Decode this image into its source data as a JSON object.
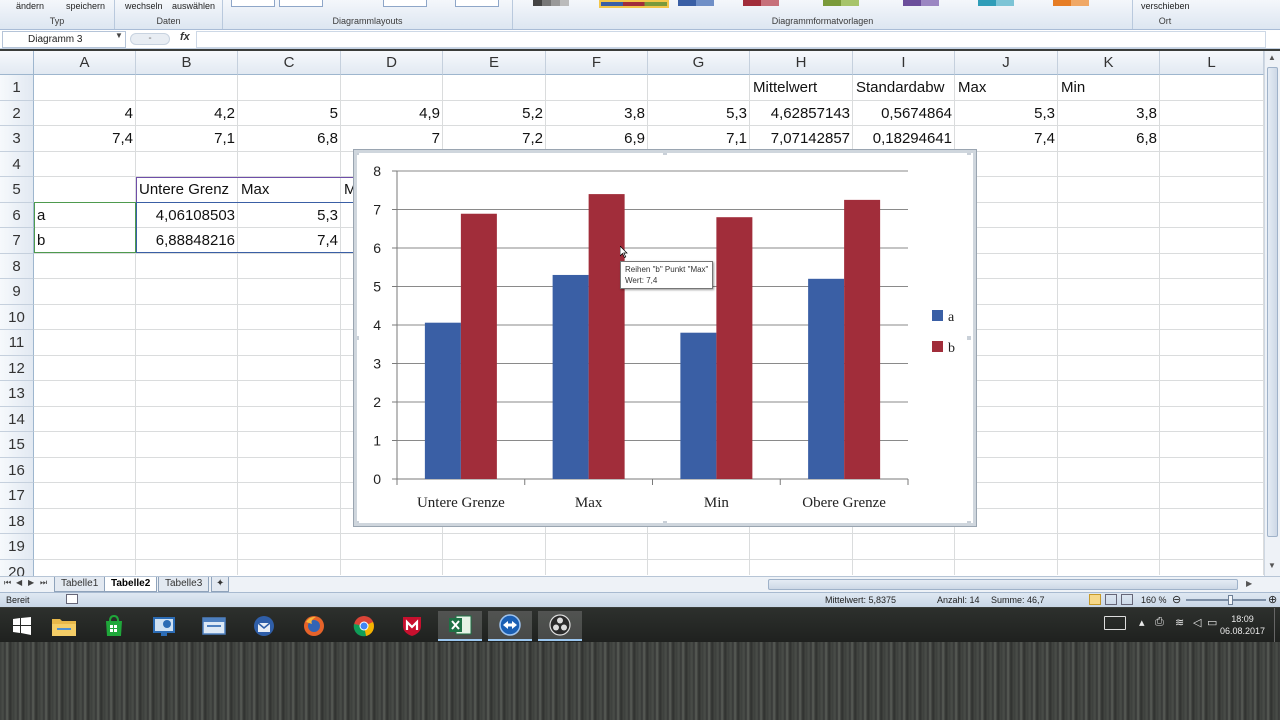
{
  "ribbon": {
    "btn_aendern": "ändern",
    "btn_speichern": "speichern",
    "group_typ": "Typ",
    "btn_wechseln": "wechseln",
    "btn_auswaehlen": "auswählen",
    "group_daten": "Daten",
    "group_layouts": "Diagrammlayouts",
    "group_formatvorlagen": "Diagrammformatvorlagen",
    "btn_verschieben": "verschieben",
    "group_ort": "Ort"
  },
  "formula_bar": {
    "name_box": "Diagramm 3",
    "fx": "fx",
    "value": ""
  },
  "columns": [
    "A",
    "B",
    "C",
    "D",
    "E",
    "F",
    "G",
    "H",
    "I",
    "J",
    "K",
    "L"
  ],
  "rows": [
    "1",
    "2",
    "3",
    "4",
    "5",
    "6",
    "7",
    "8",
    "9",
    "10",
    "11",
    "12",
    "13",
    "14",
    "15",
    "16",
    "17",
    "18",
    "19",
    "20"
  ],
  "cells": {
    "H1": "Mittelwert",
    "I1": "Standardabw",
    "J1": "Max",
    "K1": "Min",
    "A2": "4",
    "B2": "4,2",
    "C2": "5",
    "D2": "4,9",
    "E2": "5,2",
    "F2": "3,8",
    "G2": "5,3",
    "H2": "4,62857143",
    "I2": "0,5674864",
    "J2": "5,3",
    "K2": "3,8",
    "A3": "7,4",
    "B3": "7,1",
    "C3": "6,8",
    "D3": "7",
    "E3": "7,2",
    "F3": "6,9",
    "G3": "7,1",
    "H3": "7,07142857",
    "I3": "0,18294641",
    "J3": "7,4",
    "K3": "6,8",
    "B5": "Untere Grenz",
    "C5": "Max",
    "D5": "M",
    "A6": "a",
    "B6": "4,06108503",
    "C6": "5,3",
    "A7": "b",
    "B7": "6,88848216",
    "C7": "7,4"
  },
  "sheet_tabs": [
    "Tabelle1",
    "Tabelle2",
    "Tabelle3"
  ],
  "active_sheet": "Tabelle2",
  "status_bar": {
    "mode": "Bereit",
    "average": "Mittelwert: 5,8375",
    "count": "Anzahl: 14",
    "sum": "Summe: 46,7",
    "zoom": "160 %"
  },
  "chart_data": {
    "type": "bar",
    "categories": [
      "Untere Grenze",
      "Max",
      "Min",
      "Obere Grenze"
    ],
    "series": [
      {
        "name": "a",
        "values": [
          4.06,
          5.3,
          3.8,
          5.2
        ],
        "color": "#3a5fa5"
      },
      {
        "name": "b",
        "values": [
          6.89,
          7.4,
          6.8,
          7.25
        ],
        "color": "#a12d3a"
      }
    ],
    "ylim": [
      0,
      8
    ],
    "yticks": [
      "0",
      "1",
      "2",
      "3",
      "4",
      "5",
      "6",
      "7",
      "8"
    ],
    "grid": true,
    "legend_placement": "right",
    "title": "",
    "xlabel": "",
    "ylabel": ""
  },
  "tooltip": {
    "line1": "Reihen \"b\" Punkt \"Max\"",
    "line2": "Wert: 7,4"
  },
  "taskbar": {
    "time": "18:09",
    "date": "06.08.2017",
    "icons": [
      "windows-start",
      "file-explorer",
      "store",
      "remote-desktop",
      "network-window",
      "thunderbird",
      "firefox",
      "chrome",
      "mcafee",
      "excel",
      "teamviewer",
      "obs"
    ]
  }
}
